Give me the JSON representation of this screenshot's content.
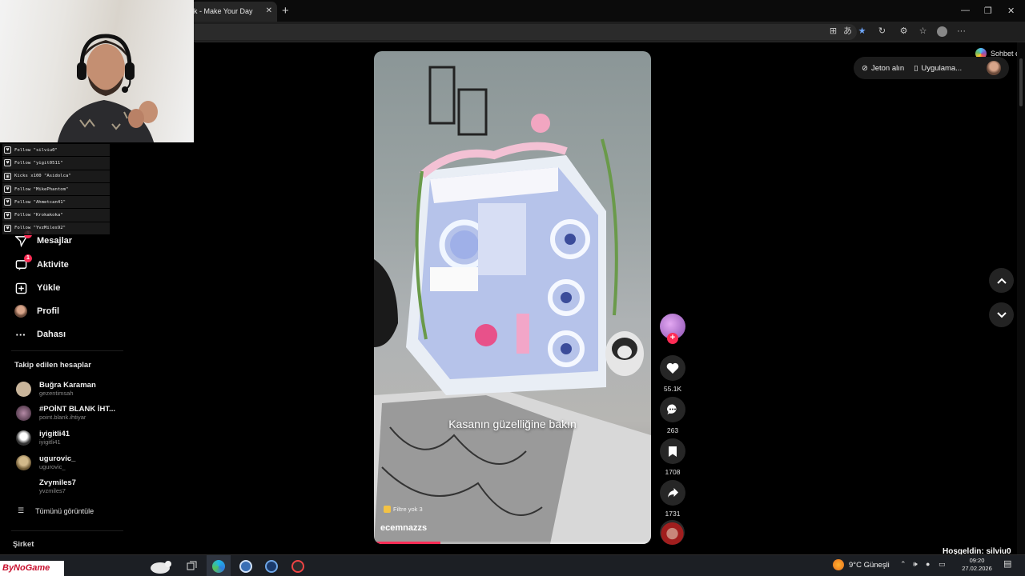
{
  "browser": {
    "tab_title": "k - Make Your Day",
    "new_tab": "+",
    "copilot_label": "Sohbet et"
  },
  "sidebar": {
    "nav": [
      {
        "label": "Mesajlar",
        "icon": "send-icon",
        "badge": "1"
      },
      {
        "label": "Aktivite",
        "icon": "activity-icon",
        "badge": "1"
      },
      {
        "label": "Yükle",
        "icon": "upload-icon",
        "badge": ""
      },
      {
        "label": "Profil",
        "icon": "profile-avatar",
        "badge": ""
      },
      {
        "label": "Dahası",
        "icon": "more-icon",
        "badge": ""
      }
    ],
    "following_title": "Takip edilen hesaplar",
    "following": [
      {
        "name": "Buğra Karaman",
        "handle": "gezentimsah",
        "color": "#c9b59b"
      },
      {
        "name": "#POİNT BLANK İHT...",
        "handle": "point.blank.ihtiyar",
        "color": "#5a3d52"
      },
      {
        "name": "iyigitli41",
        "handle": "iyigitli41",
        "color": "#e8e8e8"
      },
      {
        "name": "ugurovic_",
        "handle": "ugurovic_",
        "color": "#a08a63"
      },
      {
        "name": "Zvymiles7",
        "handle": "yvzmiles7",
        "color": "#000000"
      }
    ],
    "see_all": "Tümünü görüntüle",
    "company": "Şirket"
  },
  "follow_log": [
    {
      "text": "Follow \"silviu0\""
    },
    {
      "text": "Follow \"yigit0511\""
    },
    {
      "text": "Kicks x100 \"Asidolca\""
    },
    {
      "text": "Follow \"MikePhantom\""
    },
    {
      "text": "Follow \"Ahmetcan41\""
    },
    {
      "text": "Follow \"Krokakoka\""
    },
    {
      "text": "Follow \"YvzMiles92\""
    }
  ],
  "video": {
    "caption": "Kasanın güzelliğine bakın",
    "filter_tag": "Filtre yok 3",
    "author": "ecemnazzs",
    "progress": 0.24
  },
  "actions": {
    "likes": "55.1K",
    "comments": "263",
    "saves": "1708",
    "shares": "1731"
  },
  "topbar": {
    "coins": "Jeton alın",
    "app": "Uygulama..."
  },
  "overlay": {
    "welcome": "Hoşgeldin: silviu0",
    "brand": "ByNoGame"
  },
  "taskbar": {
    "weather": "9°C Güneşli",
    "time": "09:20",
    "date": "27.02.2026"
  },
  "colors": {
    "accent": "#fe2c55"
  }
}
